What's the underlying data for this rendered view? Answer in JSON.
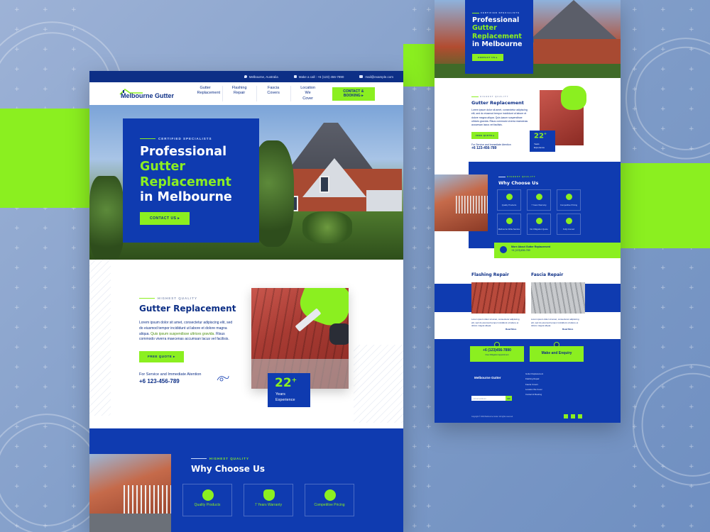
{
  "site": {
    "logo": "Melbourne Gutter",
    "topbar": {
      "location": "Melbourne, Australia",
      "phone": "Make a call : +6 (123) 456-7890",
      "email": "mail@example.com"
    },
    "nav": [
      {
        "label": "Gutter Replacement"
      },
      {
        "label": "Flashing Repair"
      },
      {
        "label": "Fascia Covers"
      },
      {
        "label": "Location We Cover"
      }
    ],
    "cta": "CONTACT & BOOKING"
  },
  "hero": {
    "eyebrow": "CERTIFIED SPECIALISTS",
    "title_1": "Professional",
    "title_2": "Gutter",
    "title_3": "Replacement",
    "title_4": "in Melbourne",
    "button": "CONTACT US"
  },
  "about": {
    "eyebrow": "HIGHEST QUALITY",
    "title": "Gutter Replacement",
    "text_1": "Lorem ipsum dolor sit amet, consectetur adipiscing elit, sed do eiusmod tempor incididunt ut labore et dolore magna aliqua.",
    "text_2": "Quis ipsum suspendisse ultrices gravida.",
    "text_3": "Risus commodo viverra maecenas accumsan lacus vel facilisis.",
    "button": "FREE QUOTE",
    "service_label": "For Service and Immediate Atention",
    "phone": "+6 123-456-789",
    "badge_number": "22",
    "badge_plus": "+",
    "badge_line1": "Years",
    "badge_line2": "Experience"
  },
  "why": {
    "eyebrow": "HIGHEST QUALITY",
    "title": "Why Choose Us",
    "cards": [
      {
        "label": "Quality Products"
      },
      {
        "label": "7 Years Warranty"
      },
      {
        "label": "Competitive Pricing"
      }
    ]
  },
  "mobile": {
    "hero_eyebrow": "CERTIFIED SPECIALISTS",
    "hero_t1": "Professional",
    "hero_t2": "Gutter",
    "hero_t3": "Replacement",
    "hero_t4": "in Melbourne",
    "hero_btn": "CONTACT US",
    "gr_eyebrow": "HIGHEST QUALITY",
    "gr_title": "Gutter Replacement",
    "gr_text": "Lorem ipsum dolor sit amet, consectetur adipiscing elit, sed do eiusmod tempor incididunt ut labore et dolore magna aliqua. Quis ipsum suspendisse ultrices gravida. Risus commodo viverra maecenas accumsan lacus vel facilisis.",
    "gr_btn": "FREE QUOTE",
    "gr_service": "For Service and Immediate Atention",
    "gr_phone": "+6 123-456-789",
    "badge_number": "22",
    "badge_plus": "+",
    "badge_line1": "Years",
    "badge_line2": "Experience",
    "why_eyebrow": "HIGHEST QUALITY",
    "why_title": "Why Choose Us",
    "why_cards": [
      {
        "label": "Quality Products"
      },
      {
        "label": "7 Years Warranty"
      },
      {
        "label": "Competitive Pricing"
      },
      {
        "label": "Melbourne Wide Service"
      },
      {
        "label": "No Obligation Quote"
      },
      {
        "label": "Fully Insured"
      }
    ],
    "more_title": "More About Gutter Replacement",
    "more_phone": "+6 (123)456-789",
    "flash_title": "Flashing Repair",
    "fascia_title": "Fascia Repair",
    "card_text": "Lorem ipsum dolor sit amet, consectetur adipiscing elit, sed do eiusmod tempor incididunt ut labore et dolore magna aliqua.",
    "read_more": "Read More",
    "cta_phone": "+6 (123)456-7890",
    "cta_phone_sub": "Free Obligation Appointment",
    "cta_enquiry": "Make and Enquiry",
    "footer_logo": "Melbourne Gutter",
    "footer_links": [
      "Gutter Replacement",
      "Flashing Repair",
      "Fascia Covers",
      "Location We Cover",
      "Contact & Booking"
    ],
    "footer_input": "Email address",
    "footer_go": "GO",
    "copyright": "Copyright © 2019 Melbourne Gutter. All rights reserved."
  },
  "colors": {
    "blue": "#0f3bb0",
    "navy": "#0d2f86",
    "green": "#8bef20"
  }
}
